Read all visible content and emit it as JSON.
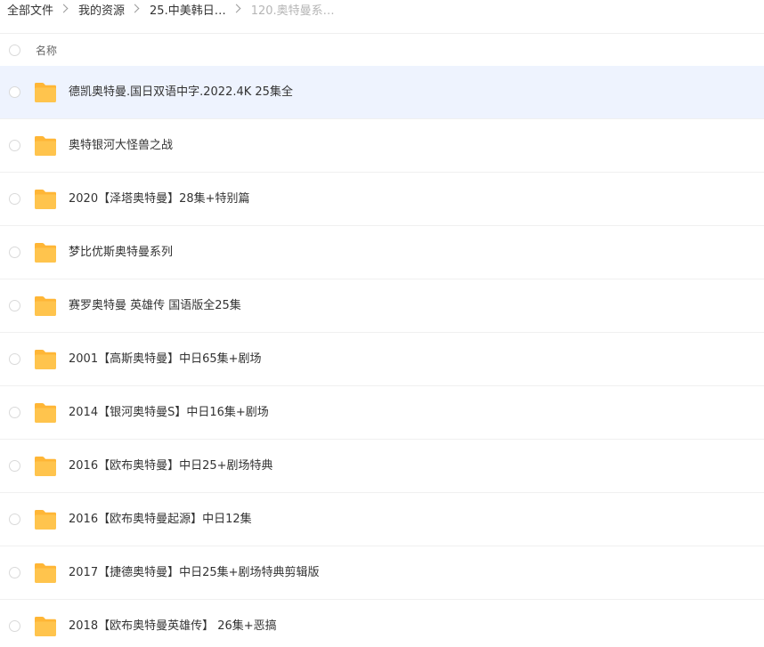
{
  "breadcrumb": {
    "items": [
      {
        "label": "全部文件"
      },
      {
        "label": "我的资源"
      },
      {
        "label": "25.中美韩日…"
      },
      {
        "label": "120.奥特曼系…"
      }
    ]
  },
  "list_header": {
    "name_label": "名称"
  },
  "icons": {
    "folder": "folder-icon",
    "chevron": "chevron-right-icon"
  },
  "colors": {
    "folder_body": "#ffc44d",
    "folder_back": "#ffb636",
    "selected_row": "#eef3fe"
  },
  "files": [
    {
      "name": "德凯奥特曼.国日双语中字.2022.4K 25集全",
      "selected": true
    },
    {
      "name": "奥特银河大怪兽之战",
      "selected": false
    },
    {
      "name": "2020【泽塔奥特曼】28集+特别篇",
      "selected": false
    },
    {
      "name": "梦比优斯奥特曼系列",
      "selected": false
    },
    {
      "name": "赛罗奥特曼 英雄传 国语版全25集",
      "selected": false
    },
    {
      "name": "2001【高斯奥特曼】中日65集+剧场",
      "selected": false
    },
    {
      "name": "2014【银河奥特曼S】中日16集+剧场",
      "selected": false
    },
    {
      "name": "2016【欧布奥特曼】中日25+剧场特典",
      "selected": false
    },
    {
      "name": "2016【欧布奥特曼起源】中日12集",
      "selected": false
    },
    {
      "name": "2017【捷德奥特曼】中日25集+剧场特典剪辑版",
      "selected": false
    },
    {
      "name": "2018【欧布奥特曼英雄传】 26集+恶搞",
      "selected": false
    }
  ]
}
